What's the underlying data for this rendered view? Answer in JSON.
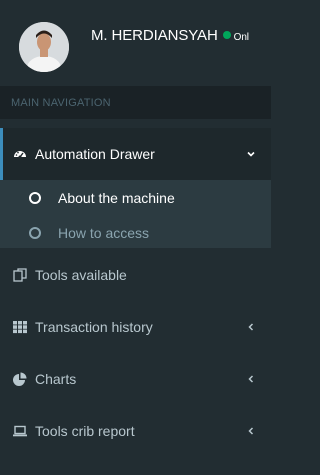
{
  "user": {
    "name": "M. HERDIANSYAH",
    "status": "Onl"
  },
  "nav": {
    "header": "MAIN NAVIGATION",
    "items": [
      {
        "label": "Automation Drawer",
        "icon": "dashboard-icon",
        "caret": "chevron-down"
      },
      {
        "label": "Tools available",
        "icon": "copy-icon"
      },
      {
        "label": "Transaction history",
        "icon": "th-icon",
        "caret": "chevron-left"
      },
      {
        "label": "Charts",
        "icon": "pie-chart-icon",
        "caret": "chevron-left"
      },
      {
        "label": "Tools crib report",
        "icon": "laptop-icon",
        "caret": "chevron-left"
      }
    ],
    "submenu": [
      {
        "label": "About the machine",
        "active": true
      },
      {
        "label": "How to access",
        "active": false
      }
    ]
  },
  "colors": {
    "sidebar_bg": "#222d32",
    "header_bg": "#1a2226",
    "active_bg": "#1e282c",
    "submenu_bg": "#2c3b41",
    "accent": "#3c8dbc",
    "online": "#00a65a",
    "text": "#b8c7ce"
  }
}
